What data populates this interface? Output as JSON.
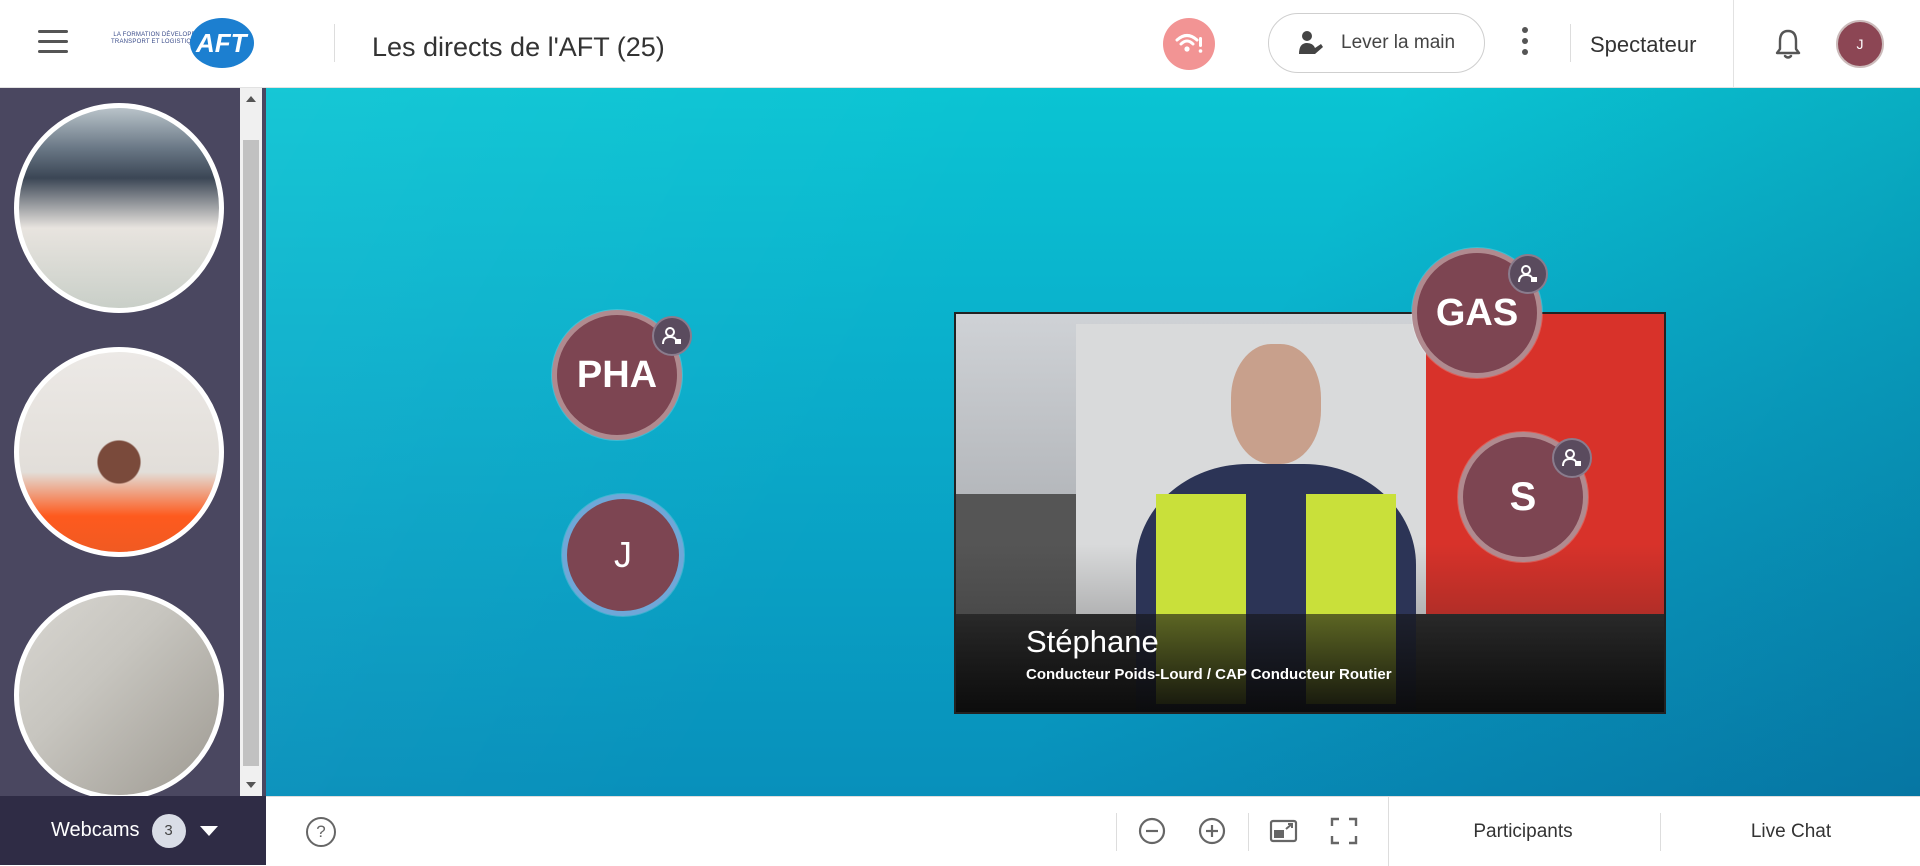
{
  "header": {
    "logo_text": "LA FORMATION DÉVELOPPE TRANSPORT ET LOGISTIQUE",
    "logo_mark": "AFT",
    "title": "Les directs de l'AFT (25)",
    "raise_hand_label": "Lever la main",
    "role_label": "Spectateur",
    "user_avatar": "J"
  },
  "sidebar": {
    "webcams_label": "Webcams",
    "webcams_count": "3"
  },
  "stage": {
    "video": {
      "name": "Stéphane",
      "subtitle": "Conducteur Poids-Lourd / CAP Conducteur Routier"
    },
    "participants": [
      {
        "initials": "PHA"
      },
      {
        "initials": "J"
      },
      {
        "initials": "GAS"
      },
      {
        "initials": "S"
      }
    ]
  },
  "bottombar": {
    "help_label": "?",
    "tabs": [
      {
        "label": "Participants"
      },
      {
        "label": "Live Chat"
      }
    ]
  },
  "colors": {
    "accent_avatar": "#7d4552",
    "connection_warning": "#f29494",
    "sidebar_bg": "#4a4760",
    "stage_teal": "#0aaecb"
  }
}
